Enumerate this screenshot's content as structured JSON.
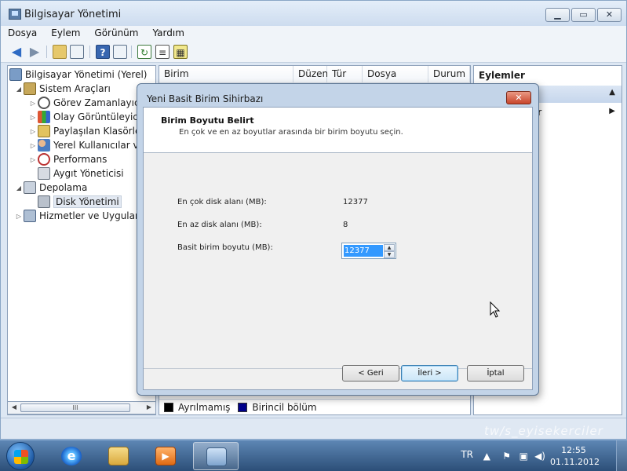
{
  "window": {
    "title": "Bilgisayar Yönetimi",
    "caption_min": "▁",
    "caption_max": "▭",
    "caption_close": "✕"
  },
  "menu": [
    "Dosya",
    "Eylem",
    "Görünüm",
    "Yardım"
  ],
  "tree": {
    "items": [
      {
        "label": "Bilgisayar Yönetimi (Yerel)",
        "icon": "computer-icon"
      },
      {
        "label": "Sistem Araçları",
        "icon": "tools-icon"
      },
      {
        "label": "Görev Zamanlayıcı",
        "icon": "clock-icon"
      },
      {
        "label": "Olay Görüntüleyici",
        "icon": "event-viewer-icon"
      },
      {
        "label": "Paylaşılan Klasörler",
        "icon": "shared-folder-icon"
      },
      {
        "label": "Yerel Kullanıcılar ve",
        "icon": "users-icon"
      },
      {
        "label": "Performans",
        "icon": "performance-icon"
      },
      {
        "label": "Aygıt Yöneticisi",
        "icon": "device-manager-icon"
      },
      {
        "label": "Depolama",
        "icon": "storage-icon"
      },
      {
        "label": "Disk Yönetimi",
        "icon": "disk-icon"
      },
      {
        "label": "Hizmetler ve Uygulama",
        "icon": "services-icon"
      }
    ],
    "scroll_thumb": "III"
  },
  "columns": [
    "Birim",
    "Düzen",
    "Tür",
    "Dosya Sistemi",
    "Durum"
  ],
  "legend": [
    {
      "label": "Ayrılmamış",
      "color": "#000000"
    },
    {
      "label": "Birincil bölüm",
      "color": "#00008b"
    }
  ],
  "actions": {
    "title": "Eylemler",
    "item": "er"
  },
  "dialog": {
    "title": "Yeni Basit Birim Sihirbazı",
    "close": "✕",
    "heading": "Birim Boyutu Belirt",
    "description": "En çok ve en az boyutlar arasında bir birim boyutu seçin.",
    "max_label": "En çok disk alanı (MB):",
    "max_value": "12377",
    "min_label": "En az disk alanı (MB):",
    "min_value": "8",
    "size_label": "Basit birim boyutu (MB):",
    "size_value": "12377",
    "back_button": "< Geri",
    "next_button": "İleri >",
    "cancel_button": "İptal"
  },
  "taskbar": {
    "language": "TR",
    "time": "12:55",
    "date": "01.11.2012",
    "ie_glyph": "e"
  },
  "watermark": "tw/s_eyisekerciler"
}
